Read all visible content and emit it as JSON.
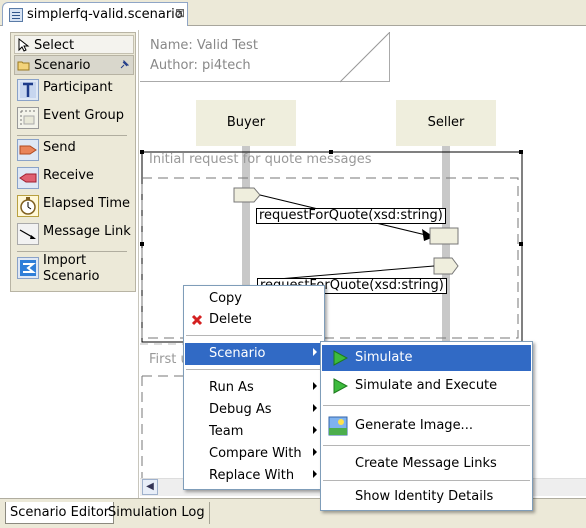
{
  "editor_tab": {
    "title": "simplerfq-valid.scenario",
    "close_symbol": "⊠"
  },
  "palette": {
    "select_label": "Select",
    "drawer_label": "Scenario",
    "items": [
      {
        "label": "Participant",
        "icon": "participant-icon"
      },
      {
        "label": "Event Group",
        "icon": "event-group-icon"
      },
      {
        "label": "Send",
        "icon": "send-icon"
      },
      {
        "label": "Receive",
        "icon": "receive-icon"
      },
      {
        "label": "Elapsed Time",
        "icon": "elapsed-time-icon"
      },
      {
        "label": "Message Link",
        "icon": "message-link-icon"
      },
      {
        "label": "Import",
        "label2": "Scenario",
        "icon": "import-scenario-icon"
      }
    ]
  },
  "diagram": {
    "name_line": "Name: Valid Test",
    "author_line": "Author: pi4tech",
    "participants": [
      "Buyer",
      "Seller"
    ],
    "group1_title": "Initial request for quote messages",
    "group2_title": "First u",
    "messages": [
      "requestForQuote(xsd:string)",
      "requestForQuote(xsd:string)"
    ]
  },
  "context_menu": {
    "items": [
      "Copy",
      "Delete",
      "Scenario",
      "Run As",
      "Debug As",
      "Team",
      "Compare With",
      "Replace With"
    ],
    "highlighted": "Scenario"
  },
  "submenu": {
    "items": [
      "Simulate",
      "Simulate and Execute",
      "Generate Image...",
      "Create Message Links",
      "Show Identity Details"
    ],
    "highlighted": "Simulate"
  },
  "bottom_tabs": [
    "Scenario Editor",
    "Simulation Log"
  ],
  "colors": {
    "highlight": "#316ac5",
    "lifeline_box": "#efeedd",
    "palette_bg": "#ece9d8"
  }
}
